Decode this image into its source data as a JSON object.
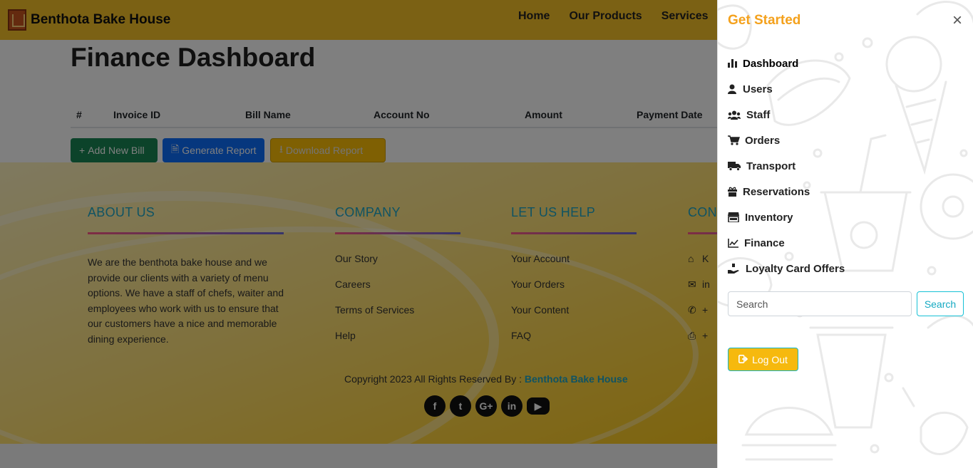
{
  "brand": {
    "name": "Benthota Bake House"
  },
  "nav": {
    "links": [
      "Home",
      "Our Products",
      "Services"
    ]
  },
  "page": {
    "title": "Finance Dashboard"
  },
  "table": {
    "headers": [
      "#",
      "Invoice ID",
      "Bill Name",
      "Account No",
      "Amount",
      "Payment Date"
    ]
  },
  "actions": {
    "add_label": "Add New Bill",
    "generate_label": "Generate Report",
    "download_label": "Download Report"
  },
  "footer": {
    "about": {
      "heading": "ABOUT US",
      "text": "We are the benthota bake house and we provide our clients with a variety of menu options. We have a staff of chefs, waiter and employees who work with us to ensure that our customers have a nice and memorable dining experience."
    },
    "company": {
      "heading": "COMPANY",
      "items": [
        "Our Story",
        "Careers",
        "Terms of Services",
        "Help"
      ]
    },
    "help": {
      "heading": "LET US HELP",
      "items": [
        "Your Account",
        "Your Orders",
        "Your Content",
        "FAQ"
      ]
    },
    "contact": {
      "heading": "CONT",
      "items": [
        "K",
        "in",
        "+",
        "+"
      ]
    },
    "copyright_prefix": "Copyright 2023 All Rights Reserved By :",
    "copyright_name": "Benthota Bake House"
  },
  "offcanvas": {
    "title": "Get Started",
    "menu": [
      {
        "label": "Dashboard",
        "icon": "chart-bar-icon"
      },
      {
        "label": "Users",
        "icon": "user-icon"
      },
      {
        "label": "Staff",
        "icon": "users-icon"
      },
      {
        "label": "Orders",
        "icon": "cart-icon"
      },
      {
        "label": "Transport",
        "icon": "truck-icon"
      },
      {
        "label": "Reservations",
        "icon": "gift-icon"
      },
      {
        "label": "Inventory",
        "icon": "store-icon"
      },
      {
        "label": "Finance",
        "icon": "chart-line-icon"
      },
      {
        "label": "Loyalty Card Offers",
        "icon": "hand-holding-icon"
      }
    ],
    "search": {
      "placeholder": "Search",
      "button_label": "Search"
    },
    "logout_label": "Log Out"
  },
  "colors": {
    "accent": "#f4a11c",
    "navbar": "#f7c228",
    "teal": "#17c1d6"
  }
}
